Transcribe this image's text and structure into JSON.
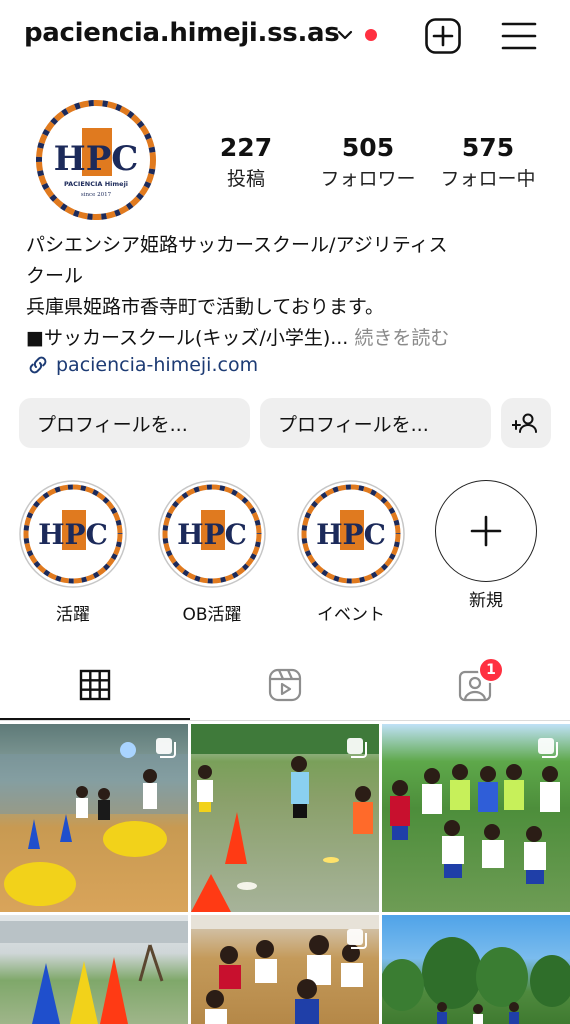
{
  "header": {
    "username": "paciencia.himeji.ss.as",
    "icons": {
      "dropdown": "chevron-down-icon",
      "add": "add-post-icon",
      "menu": "hamburger-menu-icon"
    }
  },
  "profile": {
    "avatar_text": "HPC",
    "avatar_caption": "PACIENCIA Himeji",
    "avatar_since": "since 2017",
    "stats": [
      {
        "value": "227",
        "label": "投稿"
      },
      {
        "value": "505",
        "label": "フォロワー"
      },
      {
        "value": "575",
        "label": "フォロー中"
      }
    ]
  },
  "bio": {
    "line1": "パシエンシア姫路サッカースクール/アジリティス",
    "line2": "クール",
    "line3": "兵庫県姫路市香寺町で活動しております。",
    "line4": "■サッカースクール(キッズ/小学生)...",
    "more_label": " 続きを読む",
    "link": "paciencia-himeji.com"
  },
  "buttons": {
    "edit_profile": "プロフィールを...",
    "share_profile": "プロフィールを..."
  },
  "highlights": [
    {
      "label": "活躍"
    },
    {
      "label": "OB活躍"
    },
    {
      "label": "イベント"
    },
    {
      "label": "新規"
    }
  ],
  "tabs": {
    "icons": [
      "grid-icon",
      "reels-icon",
      "tagged-icon"
    ],
    "tagged_badge": "1"
  },
  "colors": {
    "accent_red": "#ff3040",
    "link_blue": "#1d3b74",
    "button_gray": "#efefef",
    "logo_navy": "#1c2a5a",
    "logo_orange": "#e07a1f"
  }
}
